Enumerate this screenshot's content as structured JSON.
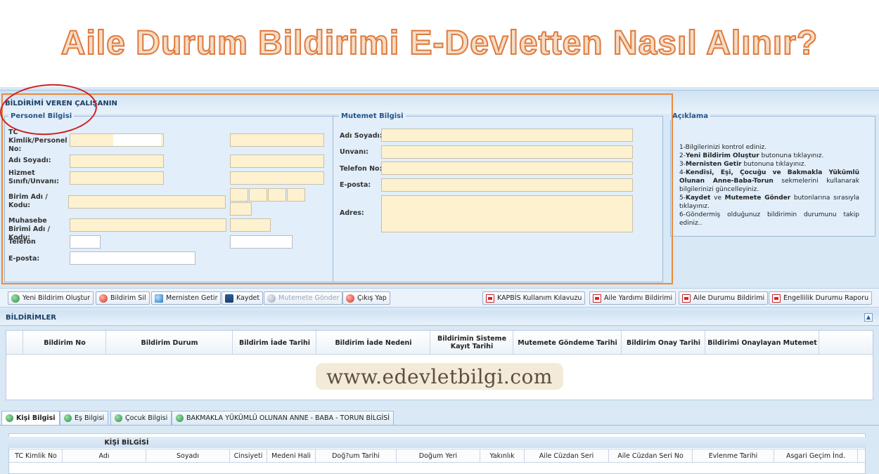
{
  "headline": "Aile Durum Bildirimi E-Devletten Nasıl Alınır?",
  "section_title": "BİLDİRİMİ VEREN ÇALIŞANIN",
  "personel": {
    "legend": "Personel Bilgisi",
    "tc_label": "TC Kimlik/Personel No:",
    "ad_soyad_label": "Adı Soyadı:",
    "hizmet_label": "Hizmet Sınıfı/Unvanı:",
    "birim_label": "Birim Adı / Kodu:",
    "muhasebe_label": "Muhasebe Birimi Adı / Kodu:",
    "telefon_label": "Telefon",
    "eposta_label": "E-posta:"
  },
  "mutemet": {
    "legend": "Mutemet Bilgisi",
    "ad_soyad_label": "Adı Soyadı:",
    "unvan_label": "Unvanı:",
    "telefon_label": "Telefon No:",
    "eposta_label": "E-posta:",
    "adres_label": "Adres:"
  },
  "aciklama": {
    "legend": "Açıklama",
    "line1": "1-Bilgilerinizi kontrol ediniz.",
    "line2_prefix": "2-",
    "line2_bold": "Yeni Bildirim Oluştur",
    "line2_rest": " butonuna tıklayınız.",
    "line3_prefix": "3-",
    "line3_bold": "Mernisten Getir",
    "line3_rest": " butonuna tıklayınız.",
    "line4_prefix": "4-",
    "line4_bold": "Kendisi, Eşi, Çocuğu ve Bakmakla Yükümlü Olunan Anne-Baba-Torun",
    "line4_rest": " sekmelerini kullanarak bilgilerinizi güncelleyiniz.",
    "line5_prefix": "5-",
    "line5_bold1": "Kaydet",
    "line5_mid": " ve ",
    "line5_bold2": "Mutemete Gönder",
    "line5_rest": " butonlarına sırasıyla tıklayınız.",
    "line6": "6-Göndermiş olduğunuz bildirimin durumunu takip ediniz.."
  },
  "toolbar": {
    "yeni": "Yeni Bildirim Oluştur",
    "sil": "Bildirim Sil",
    "mernis": "Mernisten Getir",
    "kaydet": "Kaydet",
    "mutemete": "Mutemete Gönder",
    "cikis": "Çıkış Yap",
    "kapbis": "KAPBİS Kullanım Kılavuzu",
    "aile_yardimi": "Aile Yardımı Bildirimi",
    "aile_durumu": "Aile Durumu Bildirimi",
    "engellilik": "Engellilik Durumu Raporu"
  },
  "bildirimler": {
    "title": "BİLDİRİMLER",
    "columns": [
      "Bildirim No",
      "Bildirim Durum",
      "Bildirim İade Tarihi",
      "Bildirim İade Nedeni",
      "Bildirimin Sisteme Kayıt Tarihi",
      "Mutemete Göndeme Tarihi",
      "Bildirim Onay Tarihi",
      "Bildirimi Onaylayan Mutemet"
    ]
  },
  "watermark": "www.edevletbilgi.com",
  "tabs": [
    "Kişi Bilgisi",
    "Eş Bilgisi",
    "Çocuk Bilgisi",
    "BAKMAKLA YÜKÜMLÜ OLUNAN ANNE - BABA - TORUN BİLGİSİ"
  ],
  "kisi": {
    "title": "KİŞİ BİLGİSİ",
    "columns": [
      "TC Kimlik No",
      "Adı",
      "Soyadı",
      "Cinsiyeti",
      "Medeni Hali",
      "Doğ?um Tarihi",
      "Doğum Yeri",
      "Yakınlık",
      "Aile Cüzdan Seri",
      "Aile Cüzdan Seri No",
      "Evlenme Tarihi",
      "Asgari Geçim İnd."
    ]
  },
  "colors": {
    "accent_orange": "#ea8a3c",
    "circle_red": "#d11f1f",
    "field_fill": "#fdf1cf",
    "panel_blue": "#e2eefa"
  }
}
